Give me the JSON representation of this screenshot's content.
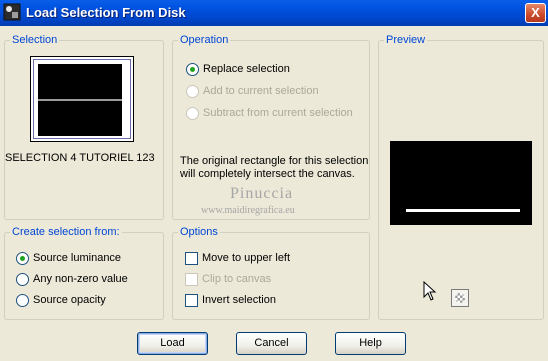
{
  "window": {
    "title": "Load Selection From Disk",
    "close_glyph": "X"
  },
  "selection": {
    "group_label": "Selection",
    "name": "SELECTION 4 TUTORIEL 123"
  },
  "operation": {
    "group_label": "Operation",
    "options": [
      {
        "label": "Replace selection",
        "selected": true,
        "enabled": true
      },
      {
        "label": "Add to current selection",
        "selected": false,
        "enabled": false
      },
      {
        "label": "Subtract from current selection",
        "selected": false,
        "enabled": false
      }
    ],
    "info_text": "The original rectangle for this selection will completely intersect the canvas."
  },
  "preview": {
    "group_label": "Preview"
  },
  "watermark": {
    "line1": "Pinuccia",
    "line2": "www.maidiregrafica.eu"
  },
  "create_from": {
    "group_label": "Create selection from:",
    "options": [
      {
        "label": "Source luminance",
        "selected": true
      },
      {
        "label": "Any non-zero value",
        "selected": false
      },
      {
        "label": "Source opacity",
        "selected": false
      }
    ]
  },
  "options": {
    "group_label": "Options",
    "items": [
      {
        "label": "Move to upper left",
        "checked": false,
        "enabled": true
      },
      {
        "label": "Clip to canvas",
        "checked": false,
        "enabled": false
      },
      {
        "label": "Invert selection",
        "checked": false,
        "enabled": true
      }
    ]
  },
  "buttons": {
    "load": "Load",
    "cancel": "Cancel",
    "help": "Help"
  },
  "colors": {
    "title_bar": "#0054E3",
    "group_label": "#0046D5",
    "dialog_bg": "#ECE9D8"
  }
}
